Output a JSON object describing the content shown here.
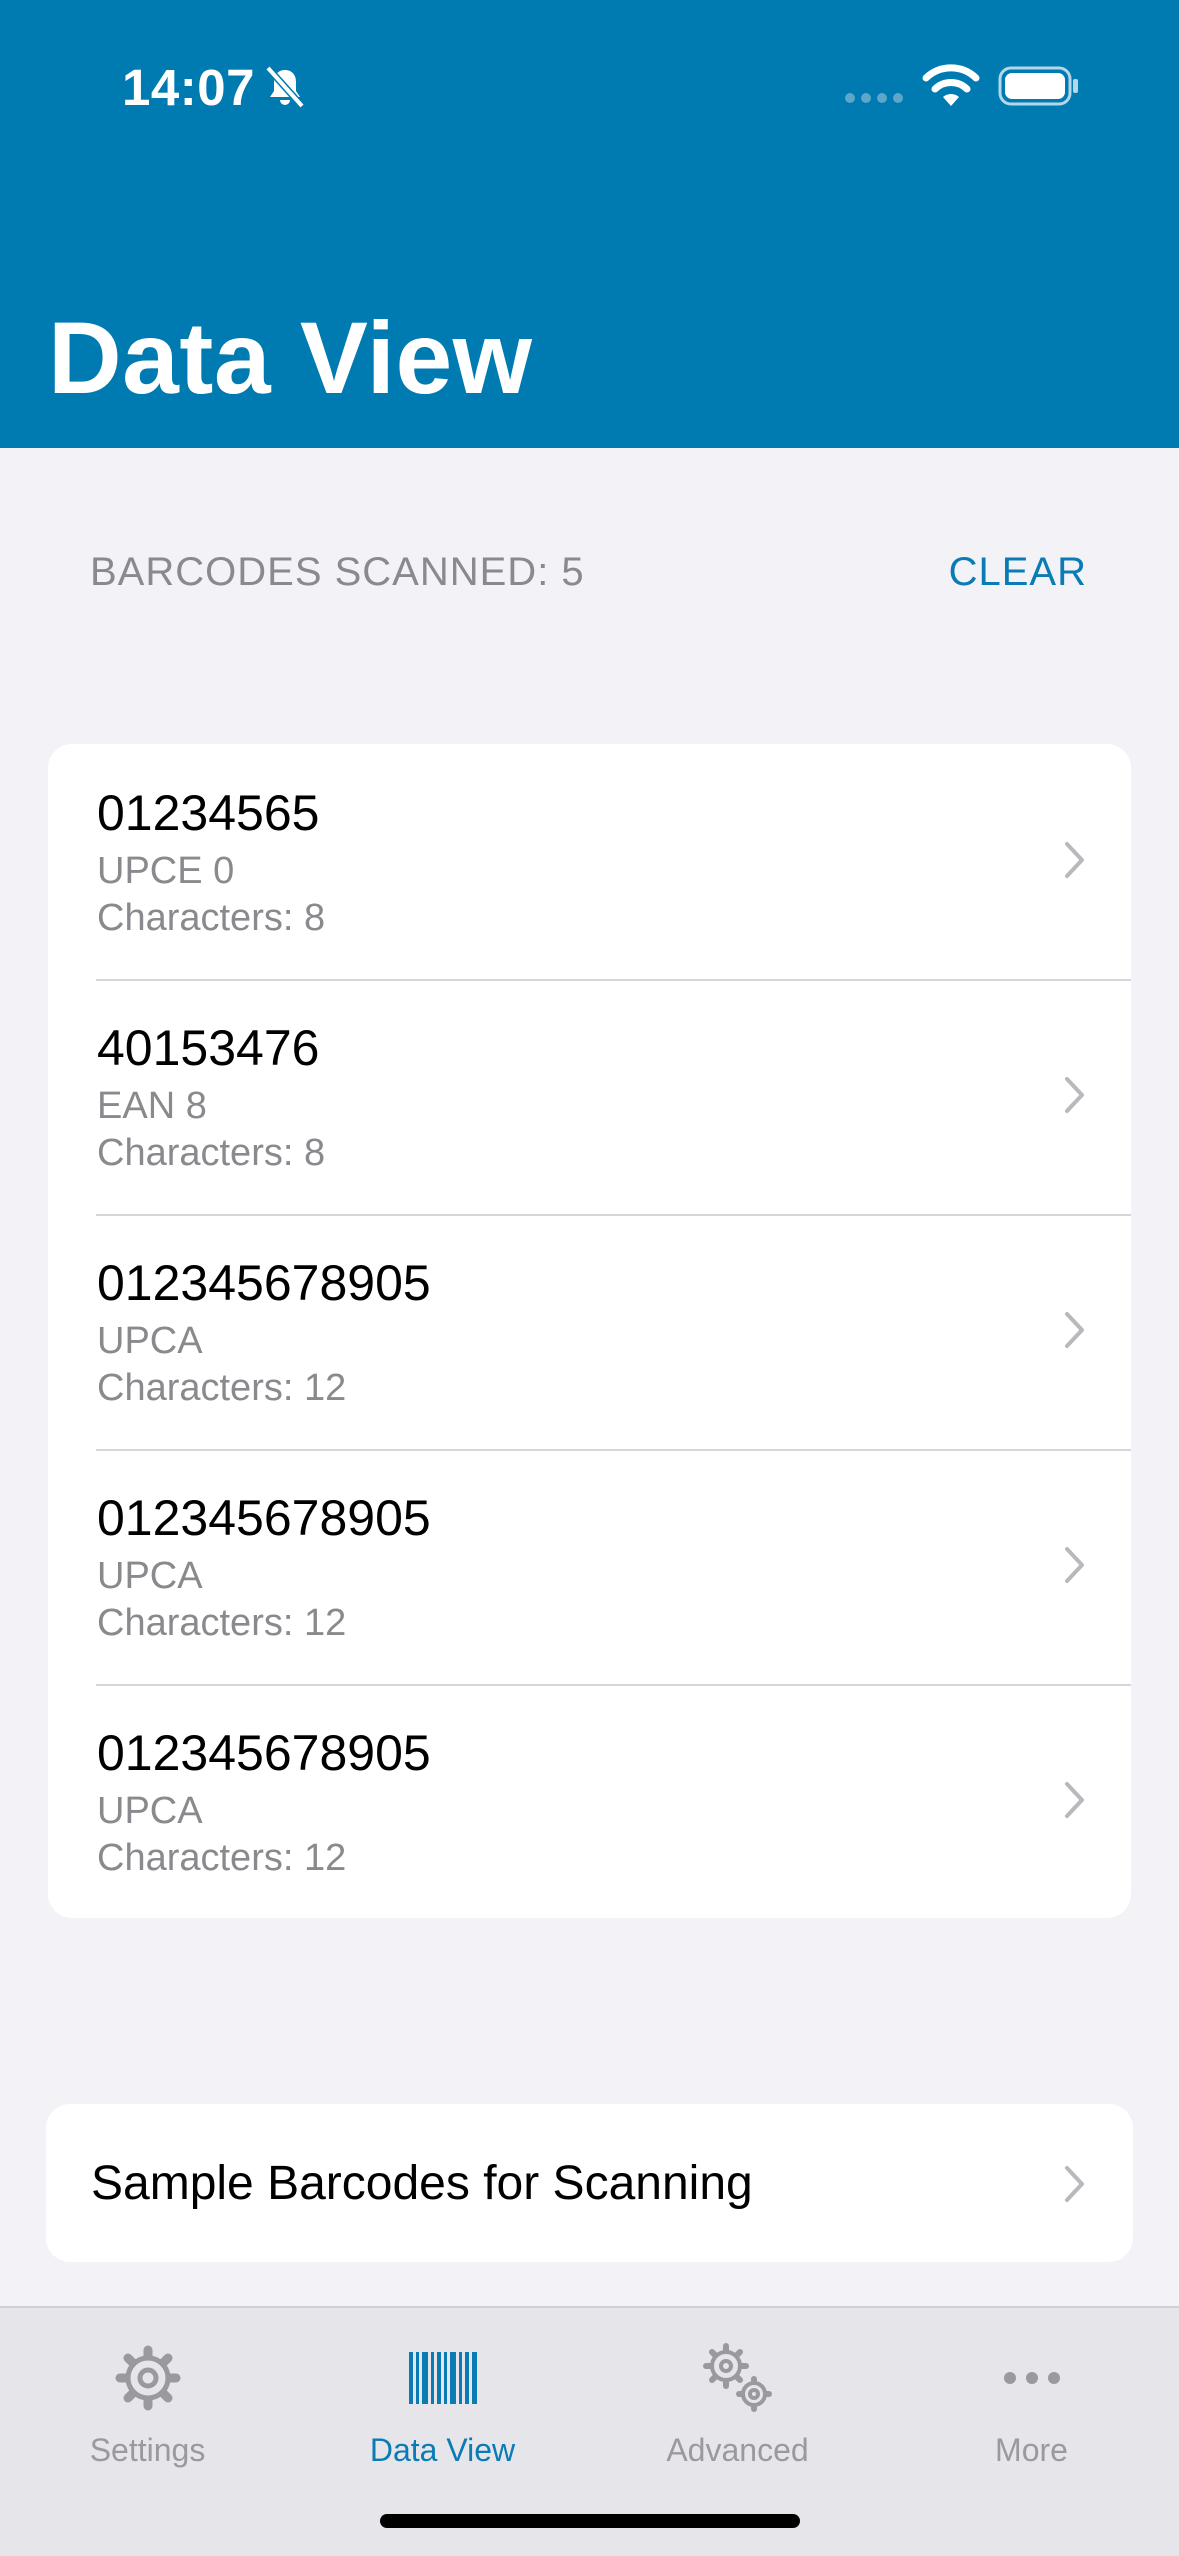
{
  "status_bar": {
    "time": "14:07"
  },
  "header": {
    "title": "Data View"
  },
  "summary": {
    "scanned_label": "BARCODES SCANNED: 5",
    "clear_label": "CLEAR"
  },
  "barcodes": [
    {
      "code": "01234565",
      "type": "UPCE 0",
      "characters": "Characters: 8"
    },
    {
      "code": "40153476",
      "type": "EAN 8",
      "characters": "Characters: 8"
    },
    {
      "code": "012345678905",
      "type": "UPCA",
      "characters": "Characters: 12"
    },
    {
      "code": "012345678905",
      "type": "UPCA",
      "characters": "Characters: 12"
    },
    {
      "code": "012345678905",
      "type": "UPCA",
      "characters": "Characters: 12"
    }
  ],
  "sample": {
    "label": "Sample Barcodes for Scanning"
  },
  "tabs": [
    {
      "label": "Settings",
      "icon": "gear-icon"
    },
    {
      "label": "Data View",
      "icon": "barcode-icon"
    },
    {
      "label": "Advanced",
      "icon": "gears-icon"
    },
    {
      "label": "More",
      "icon": "ellipsis-icon"
    }
  ],
  "colors": {
    "brand": "#007bb1",
    "accent": "#0a7bb5",
    "secondary_text": "#8a8a8e"
  }
}
